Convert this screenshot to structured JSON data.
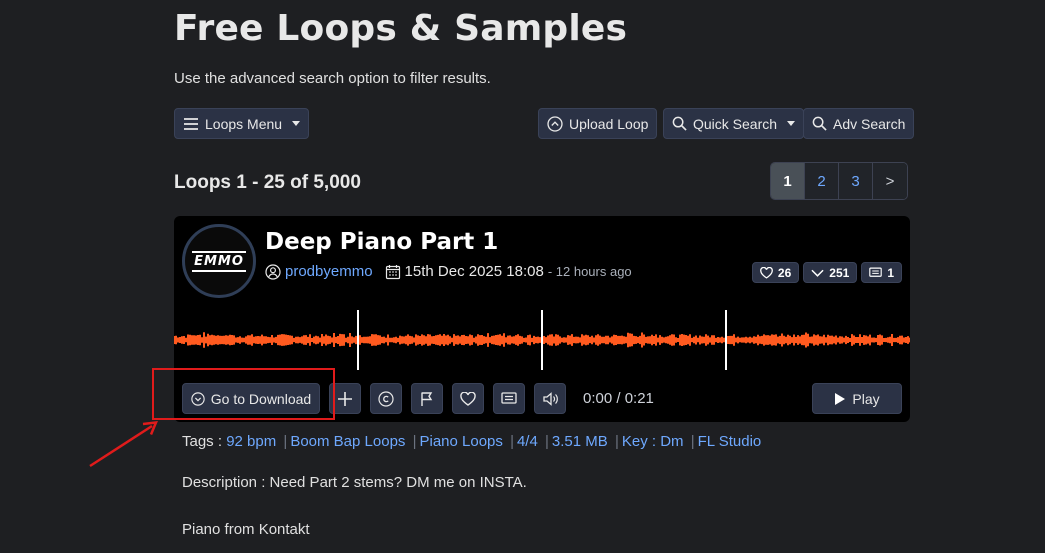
{
  "page": {
    "title": "Free Loops & Samples",
    "subtitle": "Use the advanced search option to filter results."
  },
  "toolbar": {
    "loops_menu": "Loops Menu",
    "upload_loop": "Upload Loop",
    "quick_search": "Quick Search",
    "adv_search": "Adv Search"
  },
  "results": {
    "count_text": "Loops 1 - 25 of 5,000",
    "pages": [
      "1",
      "2",
      "3",
      ">"
    ],
    "active_page": "1"
  },
  "loop": {
    "avatar_text": "EMMO",
    "title": "Deep Piano Part 1",
    "author": "prodbyemmo",
    "date": "15th Dec 2025 18:08",
    "ago": "- 12 hours ago",
    "likes": "26",
    "downloads": "251",
    "comments": "1",
    "go_to_download": "Go to Download",
    "time": "0:00 / 0:21",
    "play": "Play",
    "waveform_color": "#ff5a1f"
  },
  "tags": {
    "label": "Tags :",
    "items": [
      "92 bpm",
      "Boom Bap Loops",
      "Piano Loops",
      "4/4",
      "3.51 MB",
      "Key : Dm",
      "FL Studio"
    ]
  },
  "description": {
    "line1": "Description : Need Part 2 stems? DM me on INSTA.",
    "line2": "Piano from Kontakt"
  },
  "annotation": {
    "color": "#e01b1b"
  }
}
